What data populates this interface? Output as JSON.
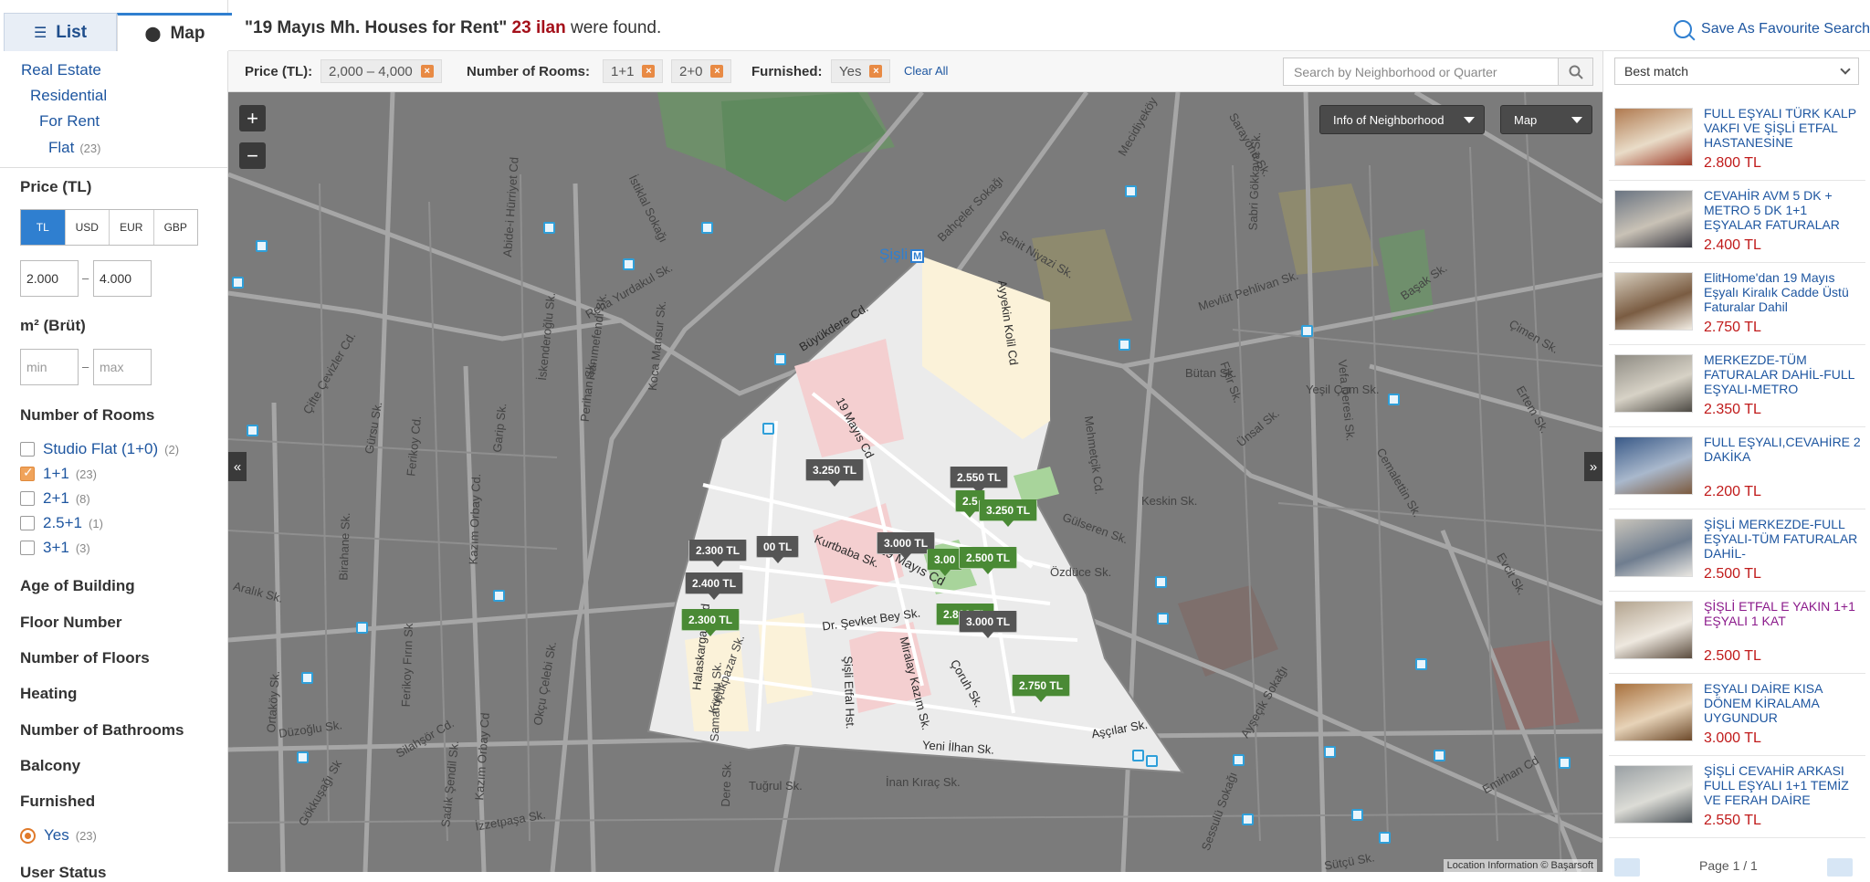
{
  "tabs": {
    "list": "List",
    "map": "Map"
  },
  "breadcrumb": [
    {
      "label": "Real Estate",
      "count": ""
    },
    {
      "label": "Residential",
      "count": ""
    },
    {
      "label": "For Rent",
      "count": ""
    },
    {
      "label": "Flat",
      "count": "(23)"
    }
  ],
  "sidebar": {
    "price_title": "Price (TL)",
    "currencies": [
      "TL",
      "USD",
      "EUR",
      "GBP"
    ],
    "active_currency": "TL",
    "price_min": "2.000",
    "price_max": "4.000",
    "area_title": "m² (Brüt)",
    "area_min_placeholder": "min",
    "area_max_placeholder": "max",
    "range_sep": "–",
    "rooms_title": "Number of Rooms",
    "rooms": [
      {
        "label": "Studio Flat (1+0)",
        "count": "(2)",
        "checked": false
      },
      {
        "label": "1+1",
        "count": "(23)",
        "checked": true
      },
      {
        "label": "2+1",
        "count": "(8)",
        "checked": false
      },
      {
        "label": "2.5+1",
        "count": "(1)",
        "checked": false
      },
      {
        "label": "3+1",
        "count": "(3)",
        "checked": false
      }
    ],
    "sections": [
      "Age of Building",
      "Floor Number",
      "Number of Floors",
      "Heating",
      "Number of Bathrooms",
      "Balcony",
      "Furnished"
    ],
    "furnished_option": {
      "label": "Yes",
      "count": "(23)",
      "selected": true
    },
    "cutoff_section": "User Status"
  },
  "header": {
    "query": "\"19 Mayıs Mh. Houses for Rent\"",
    "count": "23 ilan",
    "suffix": "were found.",
    "favourite": "Save As Favourite Search"
  },
  "filters": {
    "price_label": "Price (TL):",
    "price_value": "2,000 – 4,000",
    "rooms_label": "Number of Rooms:",
    "rooms_values": [
      "1+1",
      "2+0"
    ],
    "furnished_label": "Furnished:",
    "furnished_value": "Yes",
    "clear_all": "Clear All",
    "remove_glyph": "×",
    "search_placeholder": "Search by Neighborhood or Quarter"
  },
  "map": {
    "zoom_in": "+",
    "zoom_out": "−",
    "neighborhood_dropdown": "Info of Neighborhood",
    "type_dropdown": "Map",
    "collapse_left": "«",
    "collapse_right": "»",
    "metro_label": "Şişli",
    "metro_badge": "M",
    "attribution": "Location Information © Başarsoft",
    "price_tags": [
      {
        "label": "3.250 TL",
        "style": "dark"
      },
      {
        "label": "2.550 TL",
        "style": "dark"
      },
      {
        "label": "2.5",
        "style": "green"
      },
      {
        "label": "3.250 TL",
        "style": "green"
      },
      {
        "label": "3.000 TL",
        "style": "dark"
      },
      {
        "label": "3.00",
        "style": "green"
      },
      {
        "label": "2.500 TL",
        "style": "green"
      },
      {
        "label": "2.300 TL",
        "style": "dark"
      },
      {
        "label": "00 TL",
        "style": "dark"
      },
      {
        "label": "2.400 TL",
        "style": "dark"
      },
      {
        "label": "2.300 TL",
        "style": "green"
      },
      {
        "label": "2.800 TL",
        "style": "green"
      },
      {
        "label": "3.000 TL",
        "style": "dark"
      },
      {
        "label": "2.750 TL",
        "style": "green"
      }
    ],
    "street_labels": [
      "Büyükdere Cd.",
      "Ayyekin Kolil Cd",
      "19 Mayıs Cd",
      "Halaskargazi Cd",
      "Abide-i Hürriyet Cd",
      "İstiklal Sokağı",
      "Mevlüt Pehlivan Sk.",
      "Vefa Deresi Sk.",
      "Mehmetçik Cd.",
      "Kurtbaba Sk.",
      "19 Mayıs Cd",
      "Dr. Şevket Bey Sk.",
      "Miralay Kazım Sk.",
      "Şişli Etfal Hst.",
      "Çoruh Sk.",
      "Aşçılar Sk.",
      "Yeni İlhan Sk.",
      "Gülseren Sk.",
      "Özdüce Sk.",
      "Bütan Sk.",
      "Yeşil Çam Sk.",
      "Başak Sk.",
      "Çifte Çevizler Cd.",
      "Silahşör Cd.",
      "Kazım Orbay Cd.",
      "Ferikoy Fırın Sk",
      "Gökkuşağı Sk",
      "Tuğrul Sk.",
      "İnan Kıraç Sk.",
      "İzzetpaşa Sk.",
      "Emirhan Cd",
      "Bahçeler Sokağı",
      "Mecidiyeköy",
      "Reha Yurdakul Sk.",
      "Dere Sk.",
      "Gürsu Sk.",
      "Samanyolu Sk.",
      "Çimen Sk.",
      "Sabri Gökkaya Sk.",
      "Ertem Sk.",
      "Fikir Sk.",
      "Ünsal Sk.",
      "Birahane Sk.",
      "Düzoğlu Sk.",
      "Ortaköy Sk.",
      "Hanımefendi Sk.",
      "Koca Mansur Sk.",
      "Perihan Sk.",
      "İskenderoğlu Sk.",
      "Ferikoy Cd.",
      "Garip Sk.",
      "Aralık Sk.",
      "Sarayönü Sk.",
      "Küçükpazar Sk.",
      "Kazım Orbay Cd",
      "Okçu Çelebi Sk.",
      "Sadık Şendil Sk.",
      "Ayşeçik Sokağı",
      "Sütçü Sk.",
      "Keskin Sk.",
      "Cemalettin Sk.",
      "Sessulü Sokağı",
      "Şehit Niyazi Sk.",
      "Evcit Sk."
    ]
  },
  "right": {
    "sort": "Best match",
    "listings": [
      {
        "title": "FULL EŞYALI TÜRK KALP VAKFI VE ŞİŞLİ ETFAL HASTANESİNE",
        "price": "2.800 TL",
        "visited": false,
        "thumb": [
          "#b07a50",
          "#e9dcc8",
          "#9e3d2a"
        ]
      },
      {
        "title": "CEVAHİR AVM 5 DK + METRO 5 DK 1+1 EŞYALAR FATURALAR",
        "price": "2.400 TL",
        "visited": false,
        "thumb": [
          "#6a7482",
          "#c9c2b6",
          "#3b3b44"
        ]
      },
      {
        "title": "ElitHome'dan 19 Mayıs Eşyalı Kiralık Cadde Üstü Faturalar Dahil",
        "price": "2.750 TL",
        "visited": false,
        "thumb": [
          "#d6cdbd",
          "#7a5c42",
          "#f2ede4"
        ]
      },
      {
        "title": "MERKEZDE-TÜM FATURALAR DAHİL-FULL EŞYALI-METRO",
        "price": "2.350 TL",
        "visited": false,
        "thumb": [
          "#8f8c84",
          "#d7d2c6",
          "#4d4a44"
        ]
      },
      {
        "title": "FULL EŞYALI,CEVAHİRE 2 DAKİKA",
        "price": "2.200 TL",
        "visited": false,
        "thumb": [
          "#3a5a88",
          "#a9b8cc",
          "#7c5a3e"
        ]
      },
      {
        "title": "ŞİŞLİ MERKEZDE-FULL EŞYALI-TÜM FATURALAR DAHİL-",
        "price": "2.500 TL",
        "visited": false,
        "thumb": [
          "#c8c4bb",
          "#6f7d8f",
          "#e9e7e2"
        ]
      },
      {
        "title": "ŞİŞLİ ETFAL E YAKIN 1+1 EŞYALI 1 KAT",
        "price": "2.500 TL",
        "visited": true,
        "thumb": [
          "#b3a48f",
          "#eee8df",
          "#5b4c3e"
        ]
      },
      {
        "title": "EŞYALI DAİRE KISA DÖNEM KİRALAMA UYGUNDUR",
        "price": "3.000 TL",
        "visited": false,
        "thumb": [
          "#a8713e",
          "#e7d3b8",
          "#6d4a2b"
        ]
      },
      {
        "title": "ŞİŞLİ CEVAHİR ARKASI FULL EŞYALI 1+1 TEMİZ VE FERAH DAİRE",
        "price": "2.550 TL",
        "visited": false,
        "thumb": [
          "#9aa0a4",
          "#dcdcd6",
          "#4d545a"
        ]
      }
    ],
    "pager": "Page 1 / 1"
  },
  "colors": {
    "accent": "#2f7fd0",
    "price_red": "#c01a1a",
    "count_red": "#a4101a",
    "link_blue": "#1e56a0",
    "tag_green": "#4a8a35",
    "tag_dark": "#555555",
    "chip_x": "#e88a44"
  }
}
